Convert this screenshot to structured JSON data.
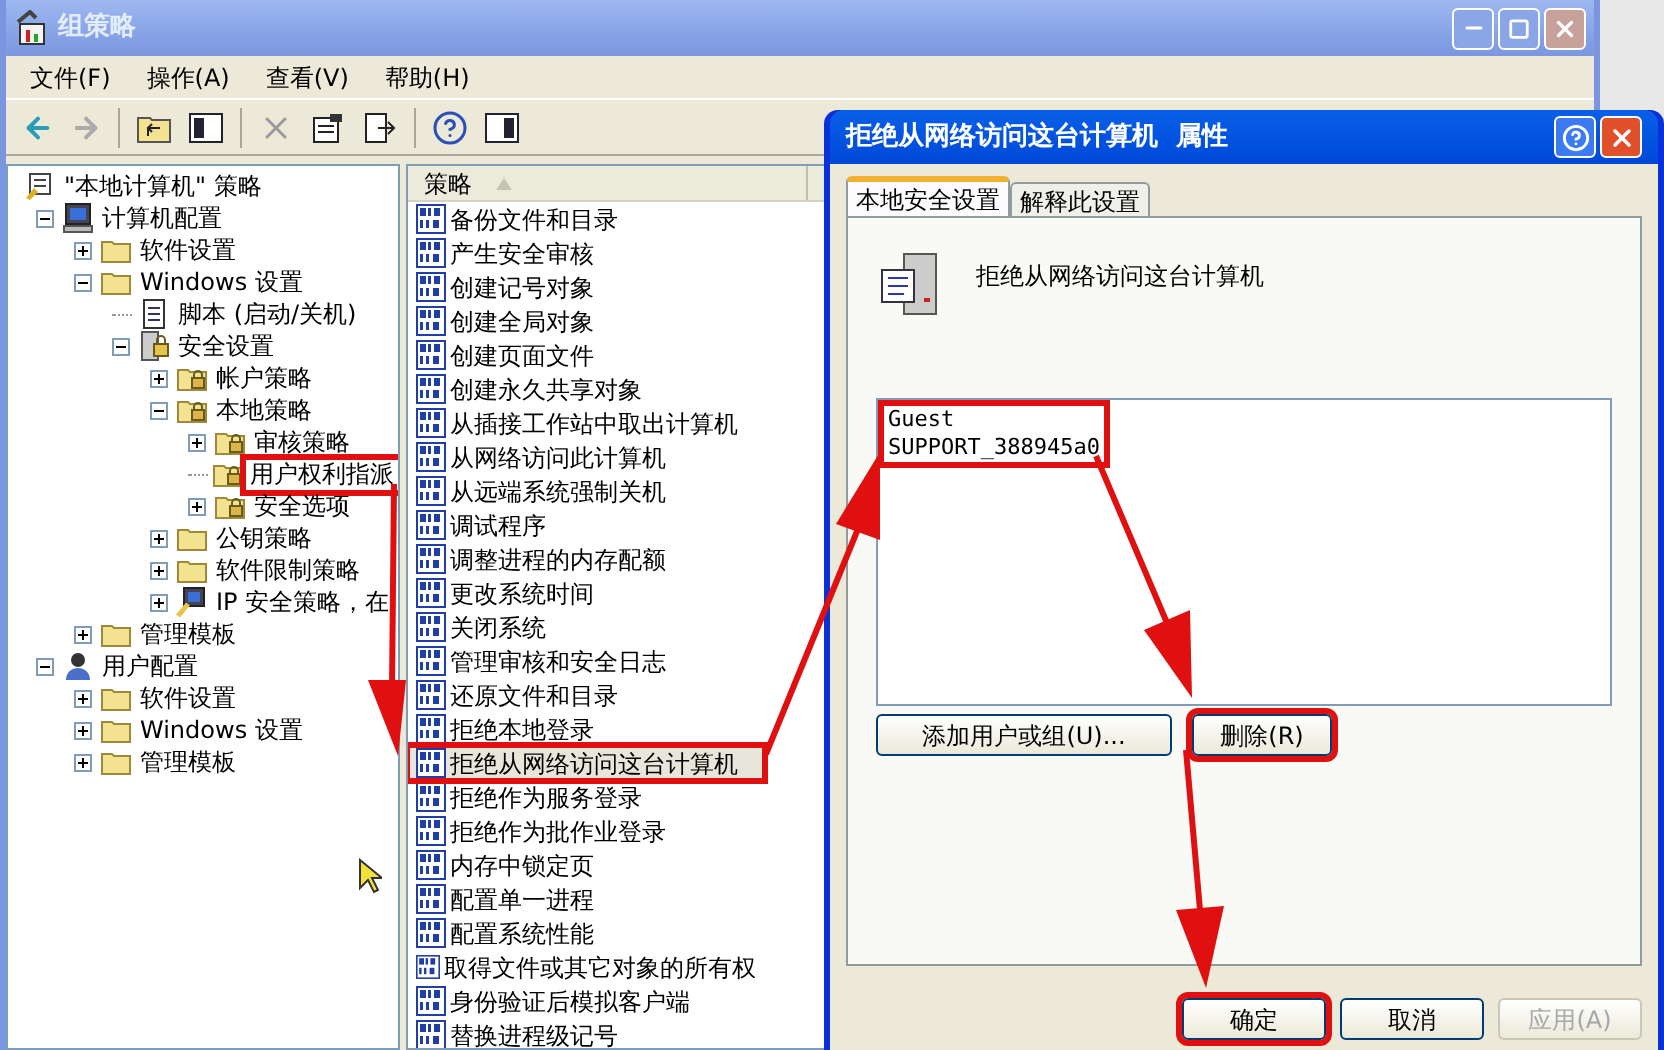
{
  "window": {
    "title": "组策略",
    "menu": [
      "文件(F)",
      "操作(A)",
      "查看(V)",
      "帮助(H)"
    ]
  },
  "tree": [
    {
      "label": "\"本地计算机\" 策略",
      "kind": "policy-root",
      "children": [
        {
          "label": "计算机配置",
          "kind": "computer",
          "expanded": true,
          "children": [
            {
              "label": "软件设置",
              "kind": "folder",
              "expanded": false
            },
            {
              "label": "Windows 设置",
              "kind": "folder",
              "expanded": true,
              "children": [
                {
                  "label": "脚本 (启动/关机)",
                  "kind": "script"
                },
                {
                  "label": "安全设置",
                  "kind": "security",
                  "expanded": true,
                  "children": [
                    {
                      "label": "帐户策略",
                      "kind": "secure-folder",
                      "expanded": false
                    },
                    {
                      "label": "本地策略",
                      "kind": "secure-folder",
                      "expanded": true,
                      "children": [
                        {
                          "label": "审核策略",
                          "kind": "secure-folder",
                          "expanded": false
                        },
                        {
                          "label": "用户权利指派",
                          "kind": "secure-folder",
                          "highlighted": true
                        },
                        {
                          "label": "安全选项",
                          "kind": "secure-folder",
                          "expanded": false
                        }
                      ]
                    },
                    {
                      "label": "公钥策略",
                      "kind": "folder",
                      "expanded": false
                    },
                    {
                      "label": "软件限制策略",
                      "kind": "folder",
                      "expanded": false
                    },
                    {
                      "label": "IP 安全策略，在",
                      "kind": "network",
                      "expanded": false
                    }
                  ]
                }
              ]
            },
            {
              "label": "管理模板",
              "kind": "folder",
              "expanded": false
            }
          ]
        },
        {
          "label": "用户配置",
          "kind": "user",
          "expanded": true,
          "children": [
            {
              "label": "软件设置",
              "kind": "folder",
              "expanded": false
            },
            {
              "label": "Windows 设置",
              "kind": "folder",
              "expanded": false
            },
            {
              "label": "管理模板",
              "kind": "folder",
              "expanded": false
            }
          ]
        }
      ]
    }
  ],
  "policy_list": {
    "column": "策略",
    "rows": [
      {
        "name": "备份文件和目录",
        "selected": false
      },
      {
        "name": "产生安全审核",
        "selected": false
      },
      {
        "name": "创建记号对象",
        "selected": false
      },
      {
        "name": "创建全局对象",
        "selected": false
      },
      {
        "name": "创建页面文件",
        "selected": false
      },
      {
        "name": "创建永久共享对象",
        "selected": false
      },
      {
        "name": "从插接工作站中取出计算机",
        "selected": false
      },
      {
        "name": "从网络访问此计算机",
        "selected": false
      },
      {
        "name": "从远端系统强制关机",
        "selected": false
      },
      {
        "name": "调试程序",
        "selected": false
      },
      {
        "name": "调整进程的内存配额",
        "selected": false
      },
      {
        "name": "更改系统时间",
        "selected": false
      },
      {
        "name": "关闭系统",
        "selected": false
      },
      {
        "name": "管理审核和安全日志",
        "selected": false
      },
      {
        "name": "还原文件和目录",
        "selected": false
      },
      {
        "name": "拒绝本地登录",
        "selected": false
      },
      {
        "name": "拒绝从网络访问这台计算机",
        "selected": true,
        "highlighted": true
      },
      {
        "name": "拒绝作为服务登录",
        "selected": false
      },
      {
        "name": "拒绝作为批作业登录",
        "selected": false
      },
      {
        "name": "内存中锁定页",
        "selected": false
      },
      {
        "name": "配置单一进程",
        "selected": false
      },
      {
        "name": "配置系统性能",
        "selected": false
      },
      {
        "name": "取得文件或其它对象的所有权",
        "selected": false
      },
      {
        "name": "身份验证后模拟客户端",
        "selected": false
      },
      {
        "name": "替换进程级记号",
        "selected": false
      }
    ]
  },
  "dialog": {
    "title": "拒绝从网络访问这台计算机  属性",
    "tabs": [
      {
        "label": "本地安全设置",
        "selected": true
      },
      {
        "label": "解释此设置",
        "selected": false
      }
    ],
    "policy_name": "拒绝从网络访问这台计算机",
    "users": [
      "Guest",
      "SUPPORT_388945a0"
    ],
    "users_highlighted": true,
    "buttons": [
      {
        "label": "添加用户或组(U)...",
        "highlighted": false
      },
      {
        "label": "删除(R)",
        "highlighted": true
      }
    ],
    "footer_buttons": [
      {
        "label": "确定",
        "highlighted": true,
        "disabled": false
      },
      {
        "label": "取消",
        "highlighted": false,
        "disabled": false
      },
      {
        "label": "应用(A)",
        "highlighted": false,
        "disabled": true
      }
    ]
  }
}
